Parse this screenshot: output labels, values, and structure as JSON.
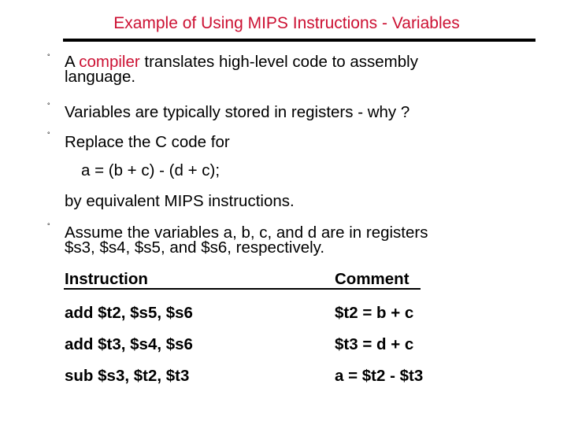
{
  "title": "Example of Using MIPS Instructions - Variables",
  "bullets": [
    {
      "prefix": "A ",
      "highlight": "compiler",
      "rest": " translates high-level code to assembly",
      "line2": "language."
    },
    {
      "text": " Variables are typically stored in registers - why ?"
    },
    {
      "text": "Replace the C code for",
      "code": "a = (b + c) - (d + c);",
      "line3": "by equivalent MIPS instructions."
    },
    {
      "text": "Assume the variables a, b, c, and d are in registers",
      "line2": "$s3, $s4, $s5, and $s6, respectively."
    }
  ],
  "bullet_glyph": "°",
  "table": {
    "headers": [
      "Instruction",
      "Comment"
    ],
    "rows": [
      [
        "add $t2, $s5, $s6",
        "$t2 = b + c"
      ],
      [
        "add $t3, $s4, $s6",
        "$t3 = d + c"
      ],
      [
        "sub $s3, $t2, $t3",
        "a = $t2 - $t3"
      ]
    ]
  },
  "colors": {
    "accent": "#cc1133",
    "text": "#000000"
  }
}
